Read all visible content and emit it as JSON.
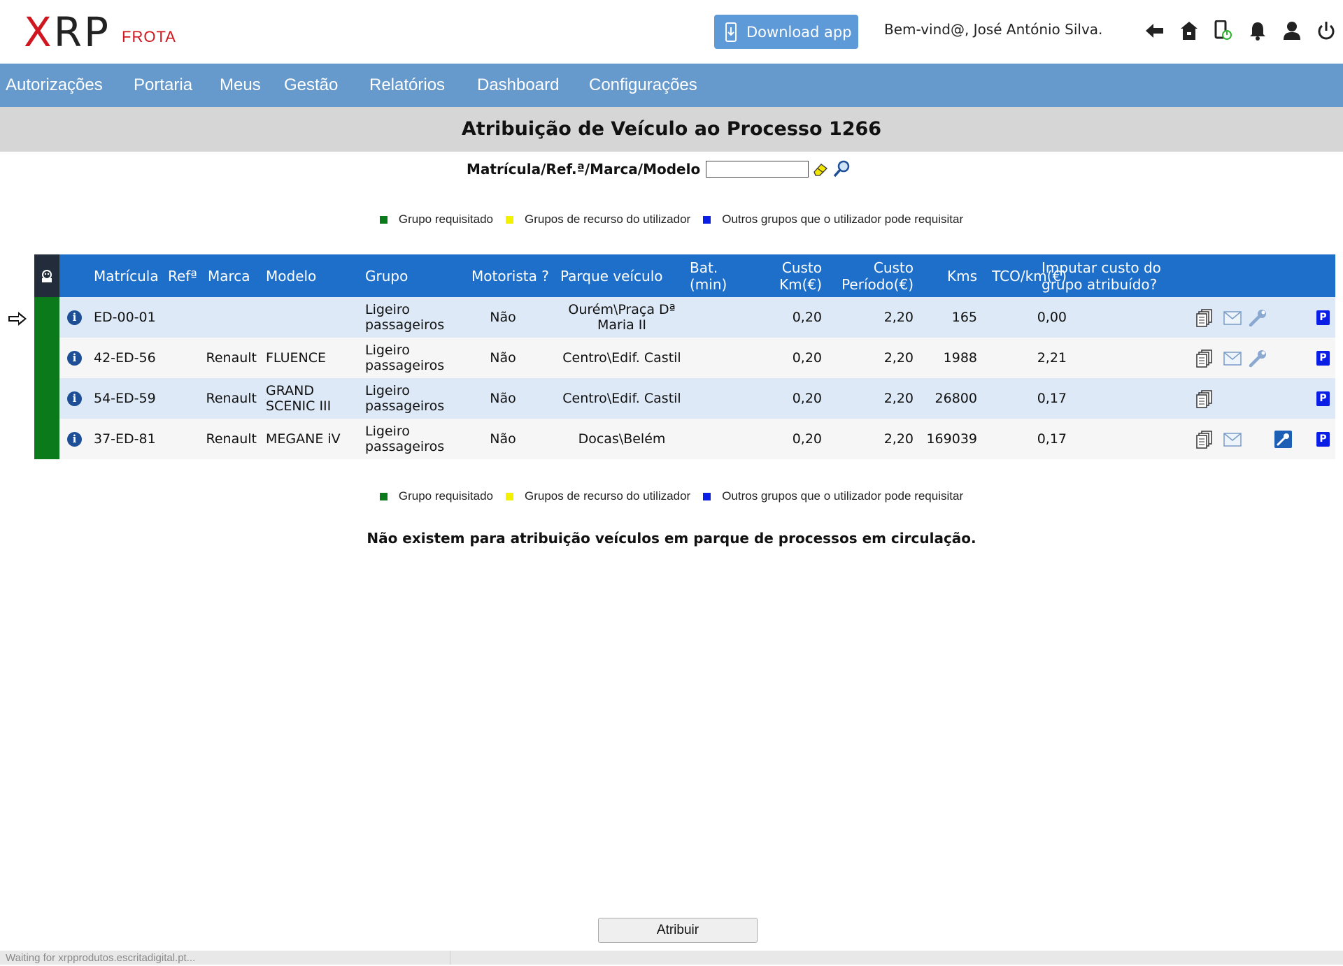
{
  "header": {
    "logo_mark_x": "X",
    "logo_mark_rest": "RP",
    "logo_sub": "FROTA",
    "download_label": "Download app",
    "welcome": "Bem-vind@, José António Silva."
  },
  "nav": {
    "items": [
      "Autorizações",
      "Portaria",
      "Meus",
      "Gestão",
      "Relatórios",
      "Dashboard",
      "Configurações"
    ]
  },
  "page": {
    "title": "Atribuição de Veículo ao Processo 1266"
  },
  "search": {
    "label": "Matrícula/Ref.ª/Marca/Modelo",
    "value": ""
  },
  "legend": {
    "items": [
      {
        "label": "Grupo requisitado",
        "color": "#0a7a1a"
      },
      {
        "label": "Grupos de recurso do utilizador",
        "color": "#f2f200"
      },
      {
        "label": "Outros grupos que o utilizador pode requisitar",
        "color": "#0a1ee6"
      }
    ]
  },
  "table": {
    "headers": {
      "matricula": "Matrícula",
      "ref": "Refª",
      "marca": "Marca",
      "modelo": "Modelo",
      "grupo": "Grupo",
      "motorista": "Motorista ?",
      "parque": "Parque veículo",
      "bat_1": "Bat.",
      "bat_2": "(min)",
      "custo_km_1": "Custo",
      "custo_km_2": "Km(€)",
      "custo_per_1": "Custo",
      "custo_per_2": "Período(€)",
      "kms": "Kms",
      "tco": "TCO/km(€)",
      "imputar_1": "Imputar custo do",
      "imputar_2": "grupo atribuído?"
    },
    "rows": [
      {
        "matricula": "ED-00-01",
        "ref": "",
        "marca": "",
        "modelo_1": "",
        "modelo_2": "",
        "grupo_1": "Ligeiro",
        "grupo_2": "passageiros",
        "motorista": "Não",
        "parque_1": "Ourém\\Praça Dª",
        "parque_2": "Maria II",
        "custo_km": "0,20",
        "custo_per": "2,20",
        "kms": "165",
        "tco": "0,00"
      },
      {
        "matricula": "42-ED-56",
        "ref": "",
        "marca": "Renault",
        "modelo_1": "FLUENCE",
        "modelo_2": "",
        "grupo_1": "Ligeiro",
        "grupo_2": "passageiros",
        "motorista": "Não",
        "parque_1": "Centro\\Edif. Castil",
        "parque_2": "",
        "custo_km": "0,20",
        "custo_per": "2,20",
        "kms": "1988",
        "tco": "2,21"
      },
      {
        "matricula": "54-ED-59",
        "ref": "",
        "marca": "Renault",
        "modelo_1": "GRAND",
        "modelo_2": "SCENIC III",
        "grupo_1": "Ligeiro",
        "grupo_2": "passageiros",
        "motorista": "Não",
        "parque_1": "Centro\\Edif. Castil",
        "parque_2": "",
        "custo_km": "0,20",
        "custo_per": "2,20",
        "kms": "26800",
        "tco": "0,17"
      },
      {
        "matricula": "37-ED-81",
        "ref": "",
        "marca": "Renault",
        "modelo_1": "MEGANE iV",
        "modelo_2": "",
        "grupo_1": "Ligeiro",
        "grupo_2": "passageiros",
        "motorista": "Não",
        "parque_1": "Docas\\Belém",
        "parque_2": "",
        "custo_km": "0,20",
        "custo_per": "2,20",
        "kms": "169039",
        "tco": "0,17"
      }
    ],
    "info_glyph": "i",
    "park_glyph": "P"
  },
  "message": "Não existem para atribuição veículos em parque de processos em circulação.",
  "actions": {
    "assign_label": "Atribuir"
  },
  "status": "Waiting for xrpprodutos.escritadigital.pt..."
}
